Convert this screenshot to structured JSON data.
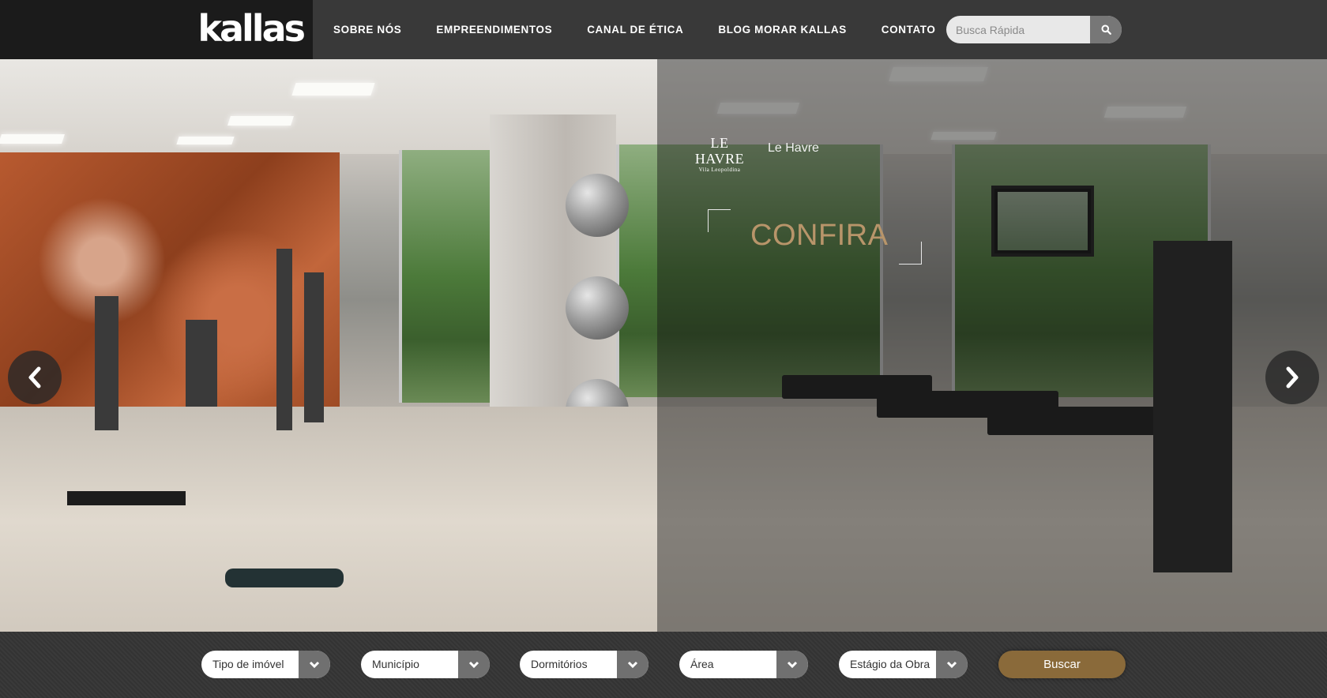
{
  "header": {
    "logo": "kallas",
    "nav": [
      {
        "label": "SOBRE NÓS"
      },
      {
        "label": "EMPREENDIMENTOS"
      },
      {
        "label": "CANAL DE ÉTICA"
      },
      {
        "label": "BLOG MORAR KALLAS"
      },
      {
        "label": "CONTATO"
      }
    ],
    "search": {
      "placeholder": "Busca Rápida",
      "value": ""
    }
  },
  "hero": {
    "promo_logo_main": "LE HAVRE",
    "promo_logo_sub": "Vila Leopoldina",
    "promo_name": "Le Havre",
    "cta": "CONFIRA"
  },
  "filters": {
    "items": [
      {
        "label": "Tipo de imóvel"
      },
      {
        "label": "Município"
      },
      {
        "label": "Dormitórios"
      },
      {
        "label": "Área"
      },
      {
        "label": "Estágio da Obra"
      }
    ],
    "submit": "Buscar"
  },
  "colors": {
    "header_bg": "#393939",
    "logo_bg": "#1b1b1b",
    "cta": "#b8956a",
    "buscar": "#8a6a3a"
  }
}
